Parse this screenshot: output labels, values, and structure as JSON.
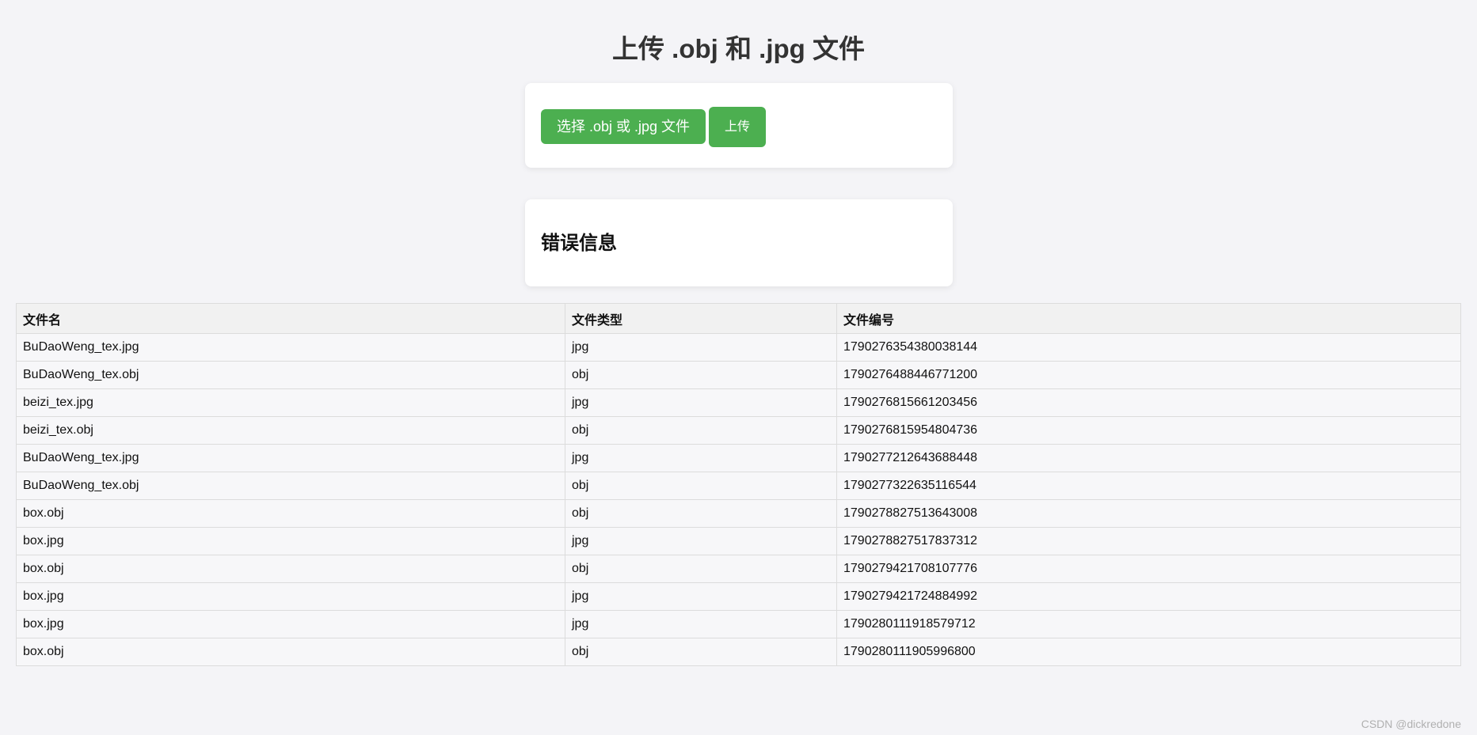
{
  "title": "上传 .obj 和 .jpg 文件",
  "upload": {
    "choose_label": "选择 .obj 或 .jpg 文件",
    "upload_label": "上传"
  },
  "errors": {
    "title": "错误信息"
  },
  "table": {
    "headers": [
      "文件名",
      "文件类型",
      "文件编号"
    ],
    "rows": [
      [
        "BuDaoWeng_tex.jpg",
        "jpg",
        "1790276354380038144"
      ],
      [
        "BuDaoWeng_tex.obj",
        "obj",
        "1790276488446771200"
      ],
      [
        "beizi_tex.jpg",
        "jpg",
        "1790276815661203456"
      ],
      [
        "beizi_tex.obj",
        "obj",
        "1790276815954804736"
      ],
      [
        "BuDaoWeng_tex.jpg",
        "jpg",
        "1790277212643688448"
      ],
      [
        "BuDaoWeng_tex.obj",
        "obj",
        "1790277322635116544"
      ],
      [
        "box.obj",
        "obj",
        "1790278827513643008"
      ],
      [
        "box.jpg",
        "jpg",
        "1790278827517837312"
      ],
      [
        "box.obj",
        "obj",
        "1790279421708107776"
      ],
      [
        "box.jpg",
        "jpg",
        "1790279421724884992"
      ],
      [
        "box.jpg",
        "jpg",
        "1790280111918579712"
      ],
      [
        "box.obj",
        "obj",
        "1790280111905996800"
      ]
    ]
  },
  "footer": {
    "credit": "CSDN @dickredone"
  },
  "colors": {
    "accent": "#4caf50",
    "background": "#f4f4f7"
  }
}
